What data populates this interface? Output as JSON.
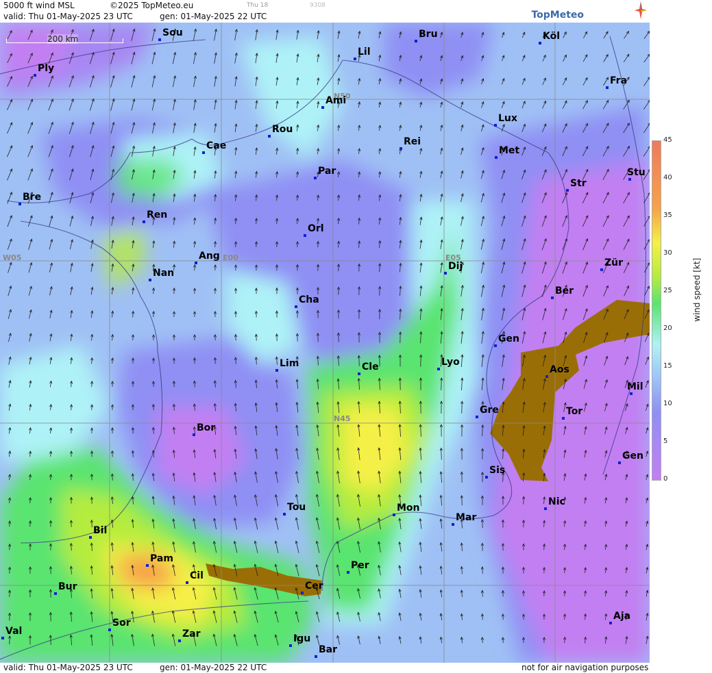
{
  "header": {
    "title": "5000 ft wind MSL",
    "copyright": "©2025 TopMeteo.eu",
    "day": "Thu 18",
    "code": "9308",
    "valid": "valid:  Thu  01-May-2025  23 UTC",
    "gen": "gen: 01-May-2025 22 UTC",
    "brand": "TopMeteo"
  },
  "footer": {
    "valid": "valid:  Thu  01-May-2025  23 UTC",
    "gen": "gen: 01-May-2025 22 UTC",
    "note": "not for air navigation purposes"
  },
  "scale_bar": "200 km",
  "legend": {
    "label": "wind speed [kt]",
    "ticks": [
      "0",
      "5",
      "10",
      "15",
      "20",
      "25",
      "30",
      "35",
      "40",
      "45"
    ]
  },
  "grid_labels": [
    "N50",
    "N45",
    "W05",
    "E00",
    "E05"
  ],
  "cities": [
    "Sou",
    "Bru",
    "Köl",
    "Ply",
    "Lil",
    "Ami",
    "Fra",
    "Lux",
    "Rou",
    "Cae",
    "Rei",
    "Met",
    "Par",
    "Str",
    "Stu",
    "Bre",
    "Ren",
    "Orl",
    "Ang",
    "Dij",
    "Zür",
    "Nan",
    "Ber",
    "Cha",
    "Gen",
    "Lim",
    "Cle",
    "Lyo",
    "Aos",
    "Mil",
    "Gre",
    "Bor",
    "Tor",
    "Sis",
    "Gen",
    "Nic",
    "Tou",
    "Mon",
    "Mar",
    "Bil",
    "Pam",
    "Cil",
    "Per",
    "Cer",
    "Bur",
    "Sor",
    "Aja",
    "Val",
    "Zar",
    "Igu",
    "Bar"
  ]
}
